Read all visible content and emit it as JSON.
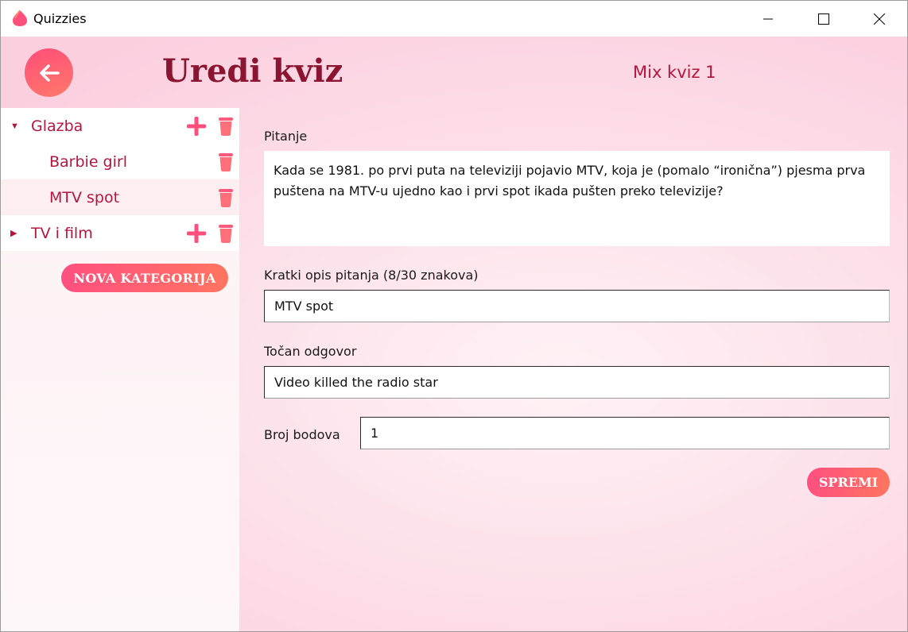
{
  "window": {
    "title": "Quizzies"
  },
  "header": {
    "title": "Uredi kviz",
    "quiz_name": "Mix kviz 1"
  },
  "sidebar": {
    "categories": [
      {
        "label": "Glazba",
        "expanded": true,
        "questions": [
          {
            "label": "Barbie girl"
          },
          {
            "label": "MTV spot",
            "selected": true
          }
        ]
      },
      {
        "label": "TV i film",
        "expanded": false,
        "questions": []
      }
    ],
    "new_category_label": "NOVA KATEGORIJA"
  },
  "form": {
    "question_label": "Pitanje",
    "question_value": "Kada se 1981. po prvi puta na televiziji pojavio MTV, koja je (pomalo “ironična”) pjesma prva puštena na MTV-u ujedno kao i prvi spot ikada pušten preko televizije?",
    "short_desc_label": "Kratki opis pitanja (8/30 znakova)",
    "short_desc_value": "MTV spot",
    "answer_label": "Točan odgovor",
    "answer_value": "Video killed the radio star",
    "points_label": "Broj bodova",
    "points_value": "1",
    "save_label": "SPREMI"
  },
  "colors": {
    "accent": "#ff4f80",
    "accent_2": "#ff7560",
    "title": "#8b1430",
    "text_accent": "#b4163e"
  },
  "icons": {
    "back": "arrow-left-icon",
    "add": "plus-icon",
    "delete": "trash-icon",
    "expanded": "caret-down-icon",
    "collapsed": "caret-right-icon"
  }
}
